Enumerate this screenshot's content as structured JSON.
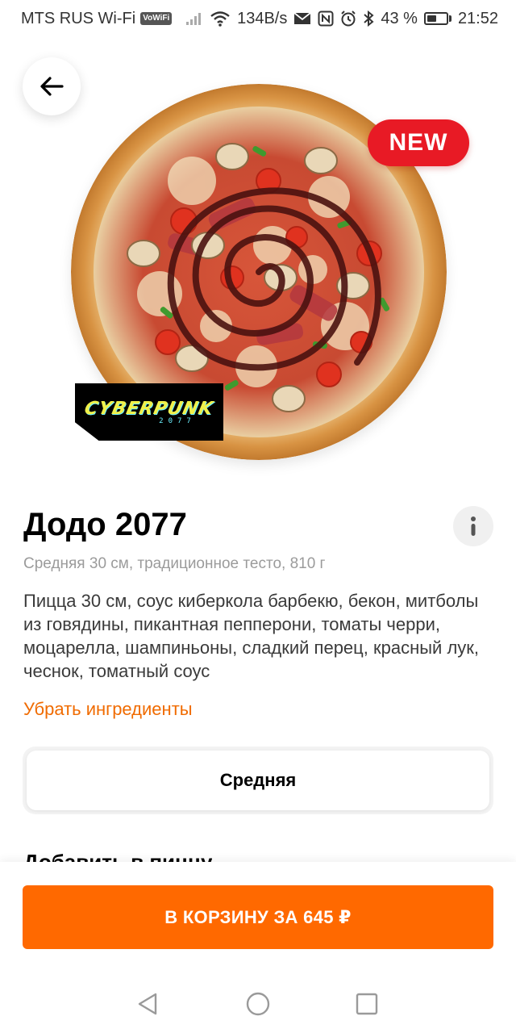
{
  "status_bar": {
    "carrier": "MTS RUS Wi-Fi",
    "vowifi_badge": "VoWiFi",
    "speed": "134B/s",
    "battery": "43 %",
    "battery_level": 0.43,
    "time": "21:52"
  },
  "product": {
    "badge": "NEW",
    "promo_logo_text": "CYBERPUNK",
    "promo_logo_year": "2077",
    "title": "Додо 2077",
    "subtitle": "Средняя 30 см, традиционное тесто, 810 г",
    "description": "Пицца 30 см, соус киберкола барбекю, бекон, митболы из говядины, пикантная пепперони, томаты черри, моцарелла, шампиньоны, сладкий перец, красный лук, чеснок, томатный соус",
    "remove_ingredients_label": "Убрать ингредиенты"
  },
  "size_selector": {
    "selected": "Средняя"
  },
  "add_section_title": "Добавить в пиццу",
  "cart_button": {
    "label": "В КОРЗИНУ ЗА 645 ₽"
  },
  "colors": {
    "accent_orange": "#ff6900",
    "link_orange": "#f06b00",
    "new_badge_red": "#e81a25"
  },
  "icons": {
    "back": "arrow-left-icon",
    "info": "info-icon",
    "nav_back": "triangle-back-icon",
    "nav_home": "circle-home-icon",
    "nav_recent": "square-recent-icon"
  }
}
